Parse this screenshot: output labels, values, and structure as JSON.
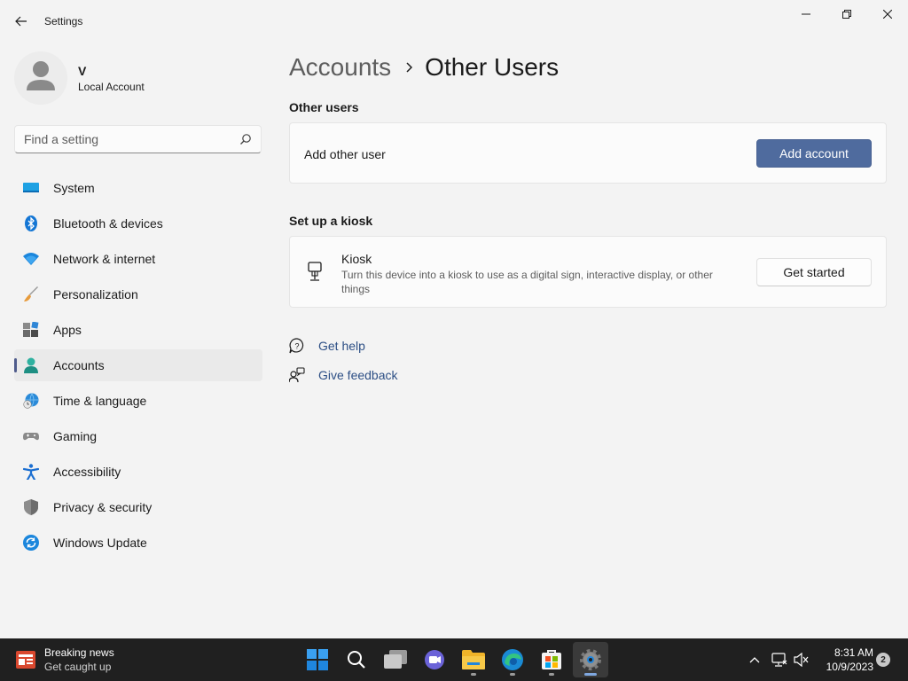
{
  "window": {
    "title": "Settings"
  },
  "profile": {
    "name": "V",
    "account_type": "Local Account"
  },
  "search": {
    "placeholder": "Find a setting"
  },
  "sidebar": {
    "items": [
      {
        "label": "System",
        "icon": "system-icon"
      },
      {
        "label": "Bluetooth & devices",
        "icon": "bluetooth-icon"
      },
      {
        "label": "Network & internet",
        "icon": "wifi-icon"
      },
      {
        "label": "Personalization",
        "icon": "brush-icon"
      },
      {
        "label": "Apps",
        "icon": "apps-icon"
      },
      {
        "label": "Accounts",
        "icon": "accounts-icon",
        "active": true
      },
      {
        "label": "Time & language",
        "icon": "globe-clock-icon"
      },
      {
        "label": "Gaming",
        "icon": "gamepad-icon"
      },
      {
        "label": "Accessibility",
        "icon": "accessibility-icon"
      },
      {
        "label": "Privacy & security",
        "icon": "shield-icon"
      },
      {
        "label": "Windows Update",
        "icon": "update-icon"
      }
    ]
  },
  "breadcrumb": {
    "parent": "Accounts",
    "current": "Other Users"
  },
  "other_users": {
    "section_title": "Other users",
    "row_label": "Add other user",
    "button_label": "Add account"
  },
  "kiosk": {
    "section_title": "Set up a kiosk",
    "title": "Kiosk",
    "description": "Turn this device into a kiosk to use as a digital sign, interactive display, or other things",
    "button_label": "Get started"
  },
  "links": {
    "help": "Get help",
    "feedback": "Give feedback"
  },
  "taskbar": {
    "news_title": "Breaking news",
    "news_subtitle": "Get caught up",
    "time": "8:31 AM",
    "date": "10/9/2023",
    "notification_count": "2"
  },
  "colors": {
    "accent": "#4f6b9e",
    "link": "#2d4f85",
    "taskbar": "#202020"
  }
}
